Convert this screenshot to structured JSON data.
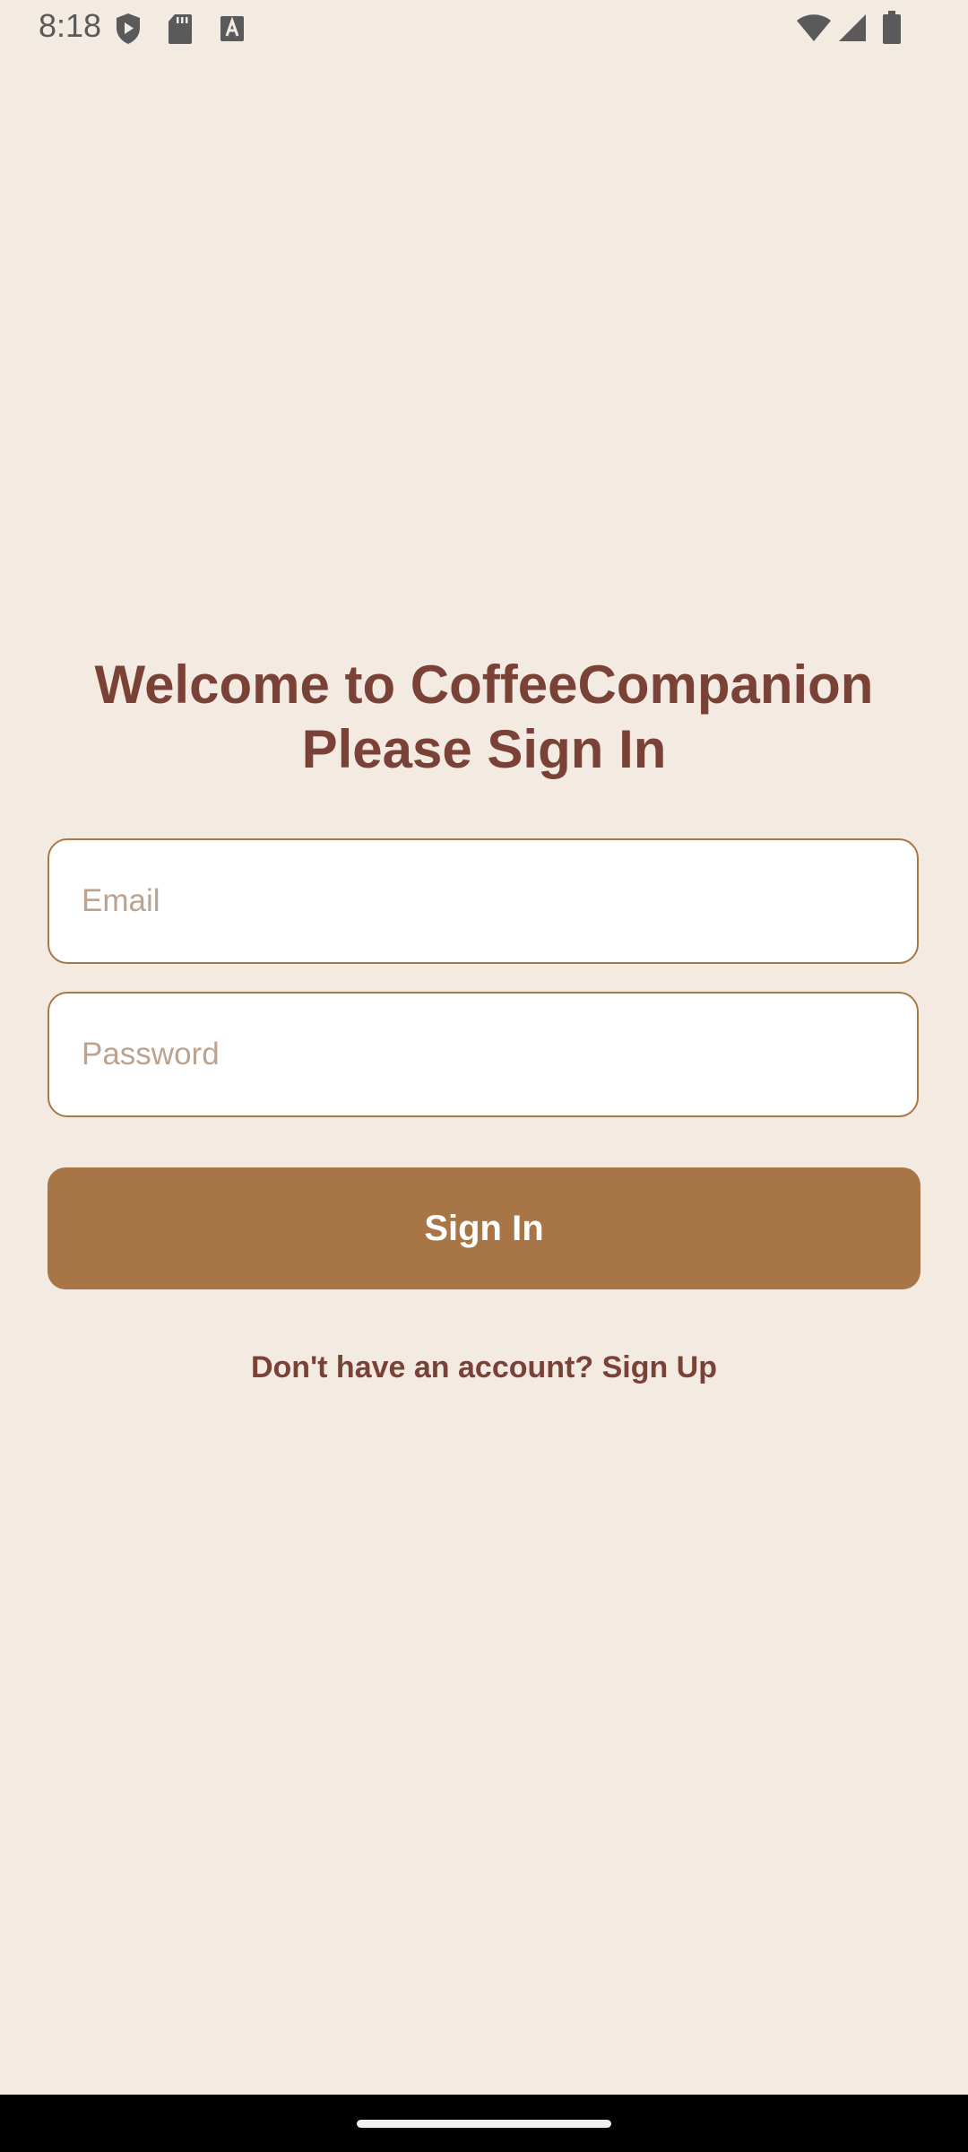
{
  "status_bar": {
    "time": "8:18",
    "icons": [
      "shield-play-icon",
      "sd-card-icon",
      "font-a-icon",
      "wifi-icon",
      "cell-signal-icon",
      "battery-icon"
    ]
  },
  "title": {
    "line1": "Welcome to CoffeeCompanion",
    "line2": "Please Sign In"
  },
  "form": {
    "email_placeholder": "Email",
    "email_value": "",
    "password_placeholder": "Password",
    "password_value": "",
    "sign_in_label": "Sign In",
    "signup_link": "Don't have an account? Sign Up"
  },
  "colors": {
    "background": "#F3EAE2",
    "title_text": "#7A4237",
    "input_border": "#A87846",
    "button_bg": "#A87646",
    "placeholder": "#BCA38F"
  }
}
